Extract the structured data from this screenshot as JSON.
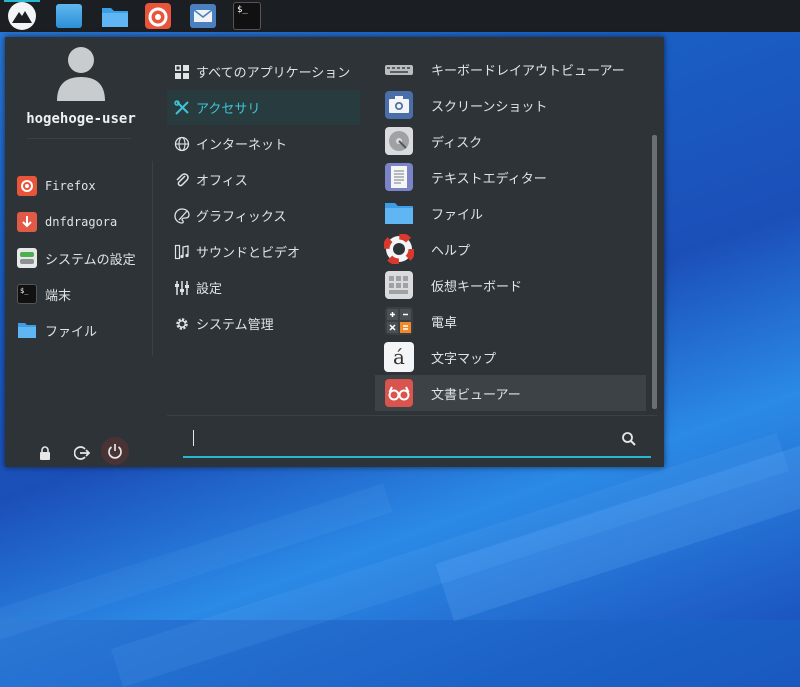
{
  "panel": {
    "launchers": [
      {
        "icon": "distro-logo-icon"
      },
      {
        "icon": "desktop-icon"
      },
      {
        "icon": "folder-icon"
      },
      {
        "icon": "firefox-icon"
      },
      {
        "icon": "mail-icon"
      },
      {
        "icon": "terminal-icon",
        "glyph": "$_"
      }
    ]
  },
  "user": {
    "name": "hogehoge-user"
  },
  "favorites": [
    {
      "label": "Firefox",
      "icon": "firefox-icon"
    },
    {
      "label": "dnfdragora",
      "icon": "dnfdragora-icon"
    },
    {
      "label": "システムの設定",
      "icon": "settings-icon"
    },
    {
      "label": "端末",
      "icon": "terminal-icon"
    },
    {
      "label": "ファイル",
      "icon": "folder-icon"
    }
  ],
  "categories": [
    {
      "label": "すべてのアプリケーション",
      "icon": "grid-icon"
    },
    {
      "label": "アクセサリ",
      "icon": "tools-icon",
      "selected": true
    },
    {
      "label": "インターネット",
      "icon": "globe-icon"
    },
    {
      "label": "オフィス",
      "icon": "paperclip-icon"
    },
    {
      "label": "グラフィックス",
      "icon": "palette-icon"
    },
    {
      "label": "サウンドとビデオ",
      "icon": "film-music-icon"
    },
    {
      "label": "設定",
      "icon": "sliders-icon"
    },
    {
      "label": "システム管理",
      "icon": "gear-icon"
    }
  ],
  "apps": [
    {
      "label": "キーボードレイアウトビューアー",
      "icon": "keyboard-icon"
    },
    {
      "label": "スクリーンショット",
      "icon": "camera-icon"
    },
    {
      "label": "ディスク",
      "icon": "disk-icon"
    },
    {
      "label": "テキストエディター",
      "icon": "text-editor-icon"
    },
    {
      "label": "ファイル",
      "icon": "folder-icon"
    },
    {
      "label": "ヘルプ",
      "icon": "lifebuoy-icon"
    },
    {
      "label": "仮想キーボード",
      "icon": "virtual-keyboard-icon"
    },
    {
      "label": "電卓",
      "icon": "calculator-icon"
    },
    {
      "label": "文字マップ",
      "icon": "charmap-icon",
      "glyph": "á"
    },
    {
      "label": "文書ビューアー",
      "icon": "document-viewer-icon",
      "highlighted": true
    }
  ],
  "search": {
    "value": ""
  },
  "actions": [
    {
      "icon": "lock-icon"
    },
    {
      "icon": "logout-icon"
    },
    {
      "icon": "power-icon"
    }
  ],
  "colors": {
    "accent": "#27b8cf",
    "menu_bg": "#2e3338",
    "panel_bg": "#1b1f23"
  }
}
